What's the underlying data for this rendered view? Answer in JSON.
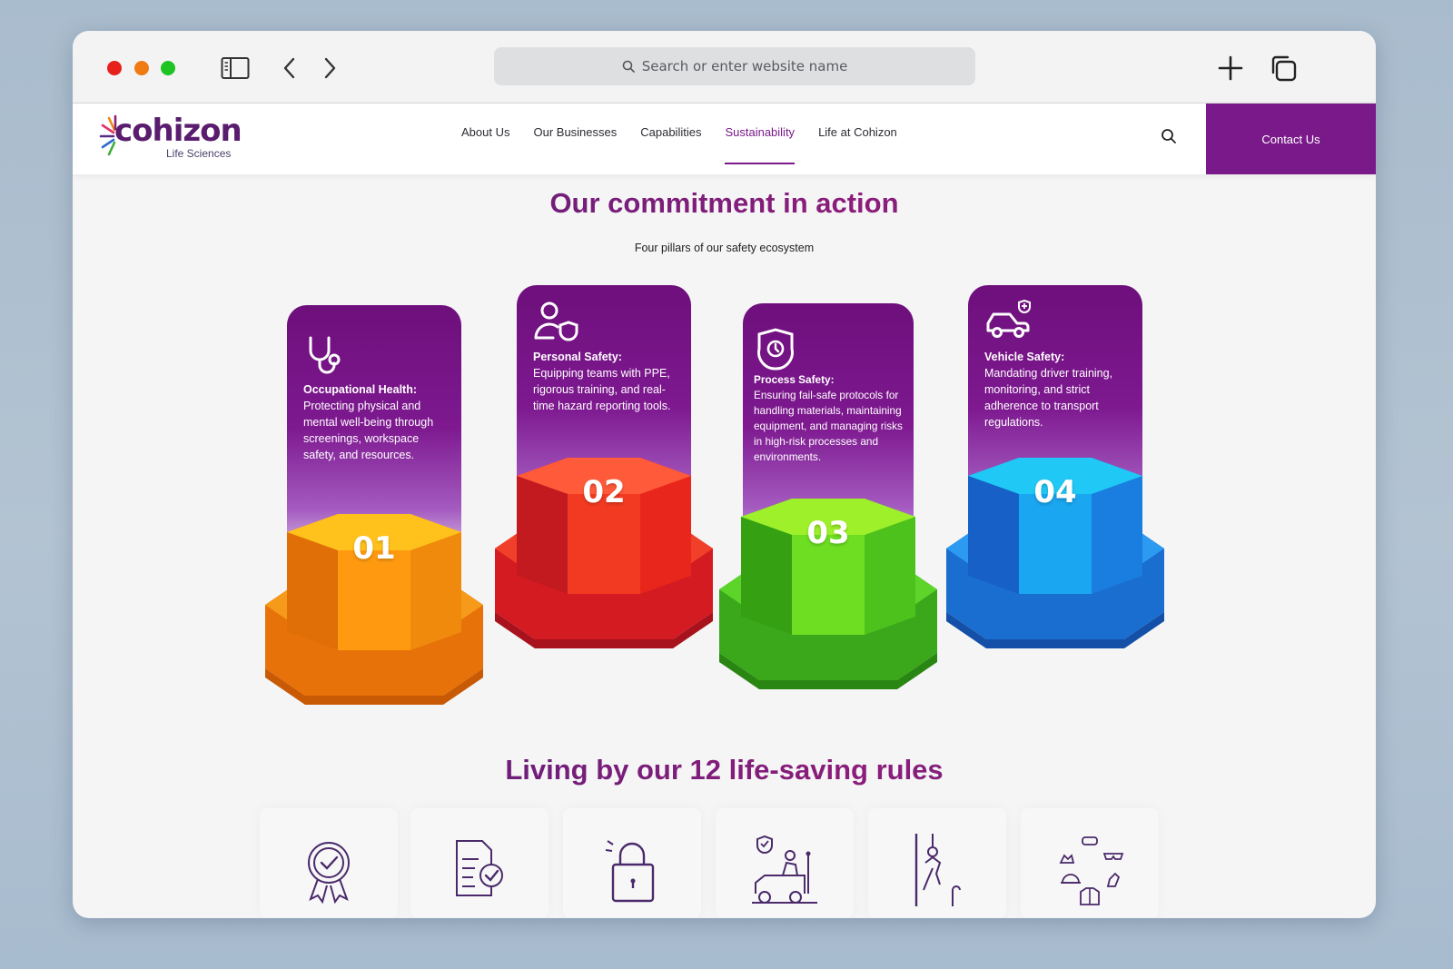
{
  "browser": {
    "search_placeholder": "Search or enter website name"
  },
  "site": {
    "logo": {
      "word": "cohizon",
      "sub": "Life Sciences"
    },
    "nav": [
      {
        "label": "About Us",
        "active": false
      },
      {
        "label": "Our Businesses",
        "active": false
      },
      {
        "label": "Capabilities",
        "active": false
      },
      {
        "label": "Sustainability",
        "active": true
      },
      {
        "label": "Life at Cohizon",
        "active": false
      }
    ],
    "contact_label": "Contact Us"
  },
  "commitment": {
    "title": "Our commitment in action",
    "subtitle": "Four pillars of our safety ecosystem",
    "pillars": [
      {
        "number": "01",
        "heading": "Occupational Health:",
        "body": "Protecting physical and mental well-being through screenings, workspace safety, and resources.",
        "icon": "stethoscope-icon",
        "color": "#f08a0c"
      },
      {
        "number": "02",
        "heading": "Personal Safety:",
        "body": "Equipping teams with PPE, rigorous training, and real-time hazard reporting tools.",
        "icon": "user-shield-icon",
        "color": "#e8261c"
      },
      {
        "number": "03",
        "heading": "Process Safety:",
        "body": "Ensuring fail-safe protocols for handling materials, maintaining equipment, and managing risks in high-risk processes and environments.",
        "icon": "shield-clock-icon",
        "color": "#4ec21c"
      },
      {
        "number": "04",
        "heading": "Vehicle Safety:",
        "body": "Mandating driver training, monitoring, and strict adherence to transport regulations.",
        "icon": "car-shield-icon",
        "color": "#1a7de0"
      }
    ]
  },
  "rules": {
    "title": "Living by our 12 life-saving rules",
    "icons": [
      "award-ribbon-icon",
      "document-check-icon",
      "padlock-icon",
      "forklift-operator-icon",
      "fall-protection-icon",
      "ppe-gear-icon"
    ]
  }
}
